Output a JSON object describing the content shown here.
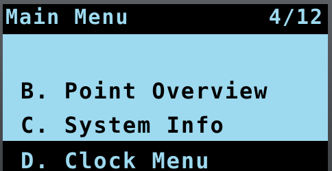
{
  "header": {
    "title": "Main Menu",
    "page_indicator": "4/12"
  },
  "menu": {
    "items": [
      {
        "label": "B. Point Overview",
        "selected": false
      },
      {
        "label": "C. System Info",
        "selected": false
      },
      {
        "label": "D. Clock Menu",
        "selected": true
      }
    ]
  },
  "colors": {
    "lcd_background": "#9dd9ef",
    "text": "#000000",
    "highlight_background": "#000000",
    "highlight_text": "#9dd9ef"
  }
}
